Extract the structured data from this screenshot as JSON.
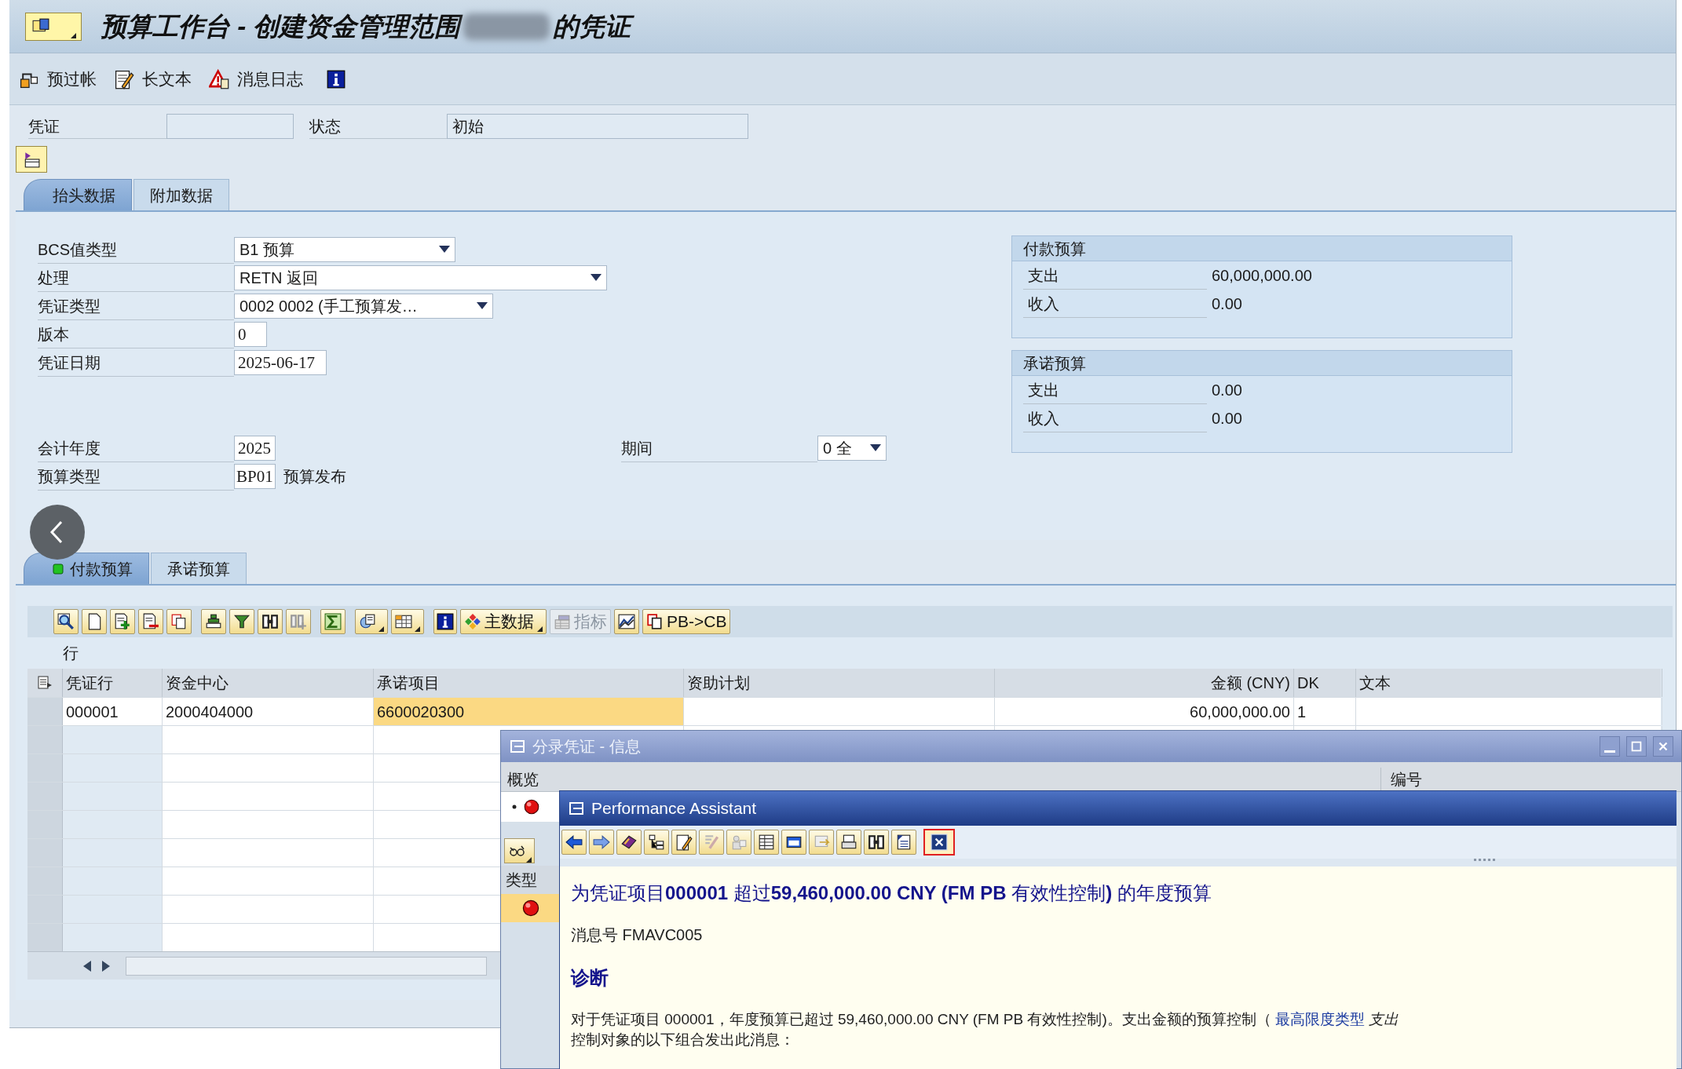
{
  "title": {
    "before": "预算工作台 - 创建资金管理范围",
    "after": "的凭证"
  },
  "toolbar": [
    {
      "label": "预过帐"
    },
    {
      "label": "长文本"
    },
    {
      "label": "消息日志"
    }
  ],
  "document": {
    "label": "凭证",
    "status_label": "状态",
    "status_value": "初始"
  },
  "header_tabs": [
    {
      "label": "抬头数据",
      "selected": true
    },
    {
      "label": "附加数据",
      "selected": false
    }
  ],
  "header_fields": [
    {
      "label": "BCS值类型",
      "value": "B1 预算",
      "kind": "dropdown"
    },
    {
      "label": "处理",
      "value": "RETN 返回",
      "kind": "dropdown"
    },
    {
      "label": "凭证类型",
      "value": "0002 0002 (手工预算发…",
      "kind": "dropdown"
    },
    {
      "label": "版本",
      "value": "0",
      "kind": "input"
    },
    {
      "label": "凭证日期",
      "value": "2025-06-17",
      "kind": "input"
    }
  ],
  "fiscal": {
    "year_label": "会计年度",
    "year": "2025",
    "period_label": "期间",
    "period": "0 全",
    "budget_type_label": "预算类型",
    "budget_type": "BP01",
    "budget_type_text": "预算发布"
  },
  "summaries": [
    {
      "title": "付款预算",
      "rows": [
        {
          "label": "支出",
          "value": "60,000,000.00"
        },
        {
          "label": "收入",
          "value": "0.00"
        }
      ]
    },
    {
      "title": "承诺预算",
      "rows": [
        {
          "label": "支出",
          "value": "0.00"
        },
        {
          "label": "收入",
          "value": "0.00"
        }
      ]
    }
  ],
  "item_tabs": [
    {
      "label": "付款预算",
      "selected": true
    },
    {
      "label": "承诺预算",
      "selected": false
    }
  ],
  "alv_buttons": [
    {
      "label": "主数据",
      "dropdown": true,
      "disabled": false
    },
    {
      "label": "指标",
      "dropdown": false,
      "disabled": true
    },
    {
      "label": "PB->CB",
      "dropdown": false,
      "disabled": false
    }
  ],
  "table": {
    "title": "行",
    "columns": [
      "凭证行",
      "资金中心",
      "承诺项目",
      "资助计划",
      "金额 (CNY)",
      "DK",
      "文本"
    ],
    "rows": [
      {
        "voucher_line": "000001",
        "funds_center": "2000404000",
        "commitment_item": "6600020300",
        "commitment_item_highlighted": true,
        "amount": "60,000,000.00",
        "dk": "1"
      }
    ]
  },
  "message_window": {
    "title": "分录凭证 - 信息",
    "overview_header": "概览",
    "number_header": "编号",
    "type_header": "类型"
  },
  "assistant": {
    "title": "Performance Assistant",
    "heading": "为凭证项目**000001** 超过**59,460,000.00 CNY (FM PB** 有效性控制**)** 的年度预算",
    "message_number": "消息号 FMAVC005",
    "diagnosis_title": "诊断",
    "diagnosis": {
      "before": "对于凭证项目 000001，年度预算已超过 59,460,000.00 CNY (FM PB 有效性控制)。支出金额的预算控制（ ",
      "link": "最高限度类型",
      "after": " *支出*"
    },
    "diagnosis_line_2": "控制对象的以下组合发出此消息："
  }
}
